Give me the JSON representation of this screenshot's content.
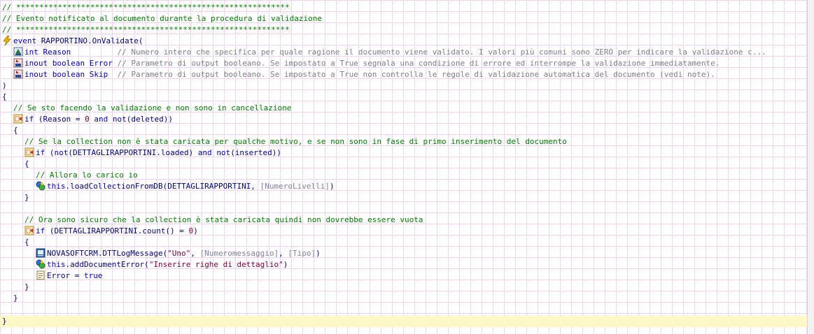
{
  "editor": {
    "banner_line_top": "// ***********************************************************",
    "header_comment": "// Evento notificato al documento durante la procedura di validazione",
    "banner_line_bottom": "// ***********************************************************",
    "event_keyword": "event",
    "event_name": "RAPPORTINO.OnValidate(",
    "params": [
      {
        "decl": "int Reason          ",
        "comment": "// Numero intero che specifica per quale ragione il documento viene validato. I valori più comuni sono ZERO per indicare la validazione c..."
      },
      {
        "decl": "inout boolean Error ",
        "comment": "// Parametro di output booleano. Se impostato a True segnala una condizione di errore ed interrompe la validazione immediatamente."
      },
      {
        "decl": "inout boolean Skip  ",
        "comment": "// Parametro di output booleano. Se impostato a True non controlla le regole di validazione automatica del documento (vedi note)."
      }
    ],
    "close_paren": ")",
    "open_brace": "{",
    "comment_1": "// Se sto facendo la validazione e non sono in cancellazione",
    "if_1": {
      "kw": "if",
      "p1": " (Reason = ",
      "num": "0",
      "p2": " and ",
      "kw2": "not",
      "p3": "(deleted))"
    },
    "comment_2": "// Se la collection non è stata caricata per qualche motivo, e se non sono in fase di primo inserimento del documento",
    "if_2": {
      "kw": "if",
      "p1": " (",
      "kw2": "not",
      "p2": "(DETTAGLIRAPPORTINI.loaded) ",
      "kw3": "and",
      "p3": " ",
      "kw4": "not",
      "p4": "(inserted))"
    },
    "comment_3": "// Allora lo carico io",
    "call_load": {
      "obj": "this",
      "method": ".loadCollectionFromDB(DETTAGLIRAPPORTINI, ",
      "arg": "[NumeroLivelli]",
      "end": ")"
    },
    "comment_4": "// Ora sono sicuro che la collection è stata caricata quindi non dovrebbe essere vuota",
    "if_3": {
      "kw": "if",
      "p1": " (DETTAGLIRAPPORTINI.count() = ",
      "num": "0",
      "p2": ")"
    },
    "call_log": {
      "obj": "NOVASOFTCRM.DTTLogMessage(",
      "str": "\"Uno\"",
      "p1": ", ",
      "arg1": "[Numeromessaggio]",
      "p2": ", ",
      "arg2": "[Tipo]",
      "end": ")"
    },
    "call_error": {
      "obj": "this",
      "method": ".addDocumentError(",
      "str": "\"Inserire righe di dettaglio\"",
      "end": ")"
    },
    "assign": {
      "lhs": "Error = ",
      "val": "true"
    },
    "brace_open": "{",
    "brace_close": "}",
    "final_brace": "}"
  },
  "colors": {
    "comment": "#008000",
    "keyword": "#0000c0",
    "identifier": "#000080",
    "string": "#800040",
    "grid": "#f0d2f0",
    "current_line": "#fdf8c4"
  }
}
